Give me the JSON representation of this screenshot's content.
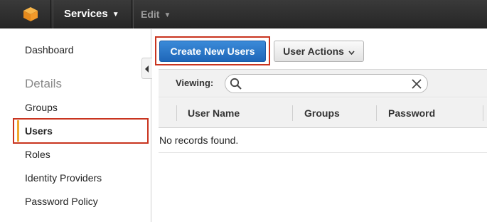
{
  "nav": {
    "logo_icon": "aws-cube-icon",
    "services_label": "Services",
    "edit_label": "Edit",
    "services_color": "#ffffff",
    "edit_color": "#9a9a9a"
  },
  "sidebar": {
    "dashboard": "Dashboard",
    "details_heading": "Details",
    "items": [
      {
        "label": "Groups",
        "active": false
      },
      {
        "label": "Users",
        "active": true
      },
      {
        "label": "Roles",
        "active": false
      },
      {
        "label": "Identity Providers",
        "active": false
      },
      {
        "label": "Password Policy",
        "active": false
      }
    ],
    "active_marker_color": "#f0a830"
  },
  "toolbar": {
    "create_label": "Create New Users",
    "actions_label": "User Actions"
  },
  "filter": {
    "viewing_label": "Viewing:",
    "search_value": "",
    "search_placeholder": ""
  },
  "table": {
    "columns": [
      "User Name",
      "Groups",
      "Password"
    ],
    "empty_message": "No records found."
  },
  "colors": {
    "primary_button": "#2a78cc",
    "highlight_box": "#c9341f",
    "topbar": "#2f2f2f"
  }
}
